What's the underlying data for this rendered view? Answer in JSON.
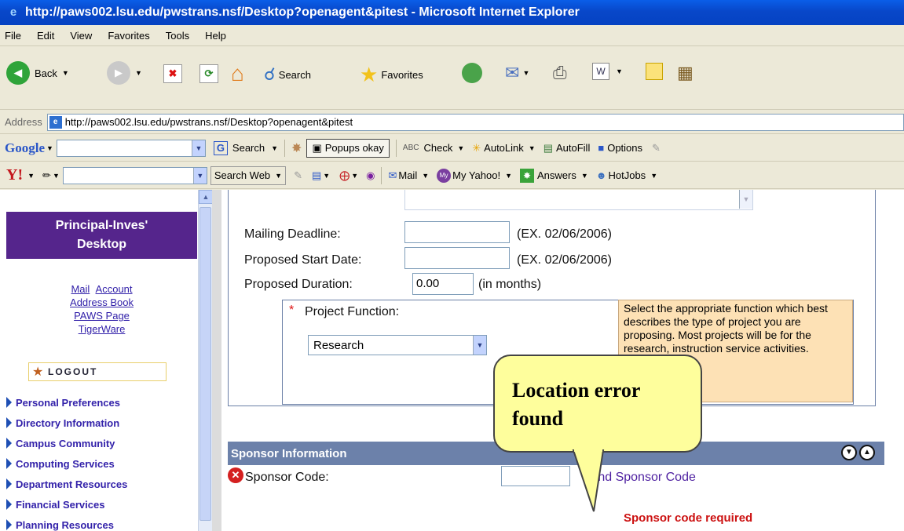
{
  "window": {
    "title": "http://paws002.lsu.edu/pwstrans.nsf/Desktop?openagent&pitest - Microsoft Internet Explorer"
  },
  "menu": [
    "File",
    "Edit",
    "View",
    "Favorites",
    "Tools",
    "Help"
  ],
  "toolbar": {
    "back": "Back",
    "search": "Search",
    "favorites": "Favorites"
  },
  "address": {
    "label": "Address",
    "url": "http://paws002.lsu.edu/pwstrans.nsf/Desktop?openagent&pitest"
  },
  "google": {
    "logo": "Google",
    "search": "Search",
    "popups": "Popups okay",
    "check": "Check",
    "autolink": "AutoLink",
    "autofill": "AutoFill",
    "options": "Options"
  },
  "yahoo": {
    "logo": "Y!",
    "search_web": "Search Web",
    "mail": "Mail",
    "my_yahoo": "My Yahoo!",
    "answers": "Answers",
    "hotjobs": "HotJobs"
  },
  "sidebar": {
    "title_line1": "Principal-Inves'",
    "title_line2": "Desktop",
    "link_mail": "Mail",
    "link_account": "Account",
    "link_address_book": "Address Book",
    "link_paws_page": "PAWS Page",
    "link_tigerware": "TigerWare",
    "logout": "LOGOUT",
    "nav": [
      "Personal Preferences",
      "Directory Information",
      "Campus Community",
      "Computing Services",
      "Department Resources",
      "Financial Services",
      "Planning Resources"
    ]
  },
  "form": {
    "mailing_deadline": "Mailing Deadline:",
    "proposed_start": "Proposed Start Date:",
    "proposed_duration": "Proposed Duration:",
    "date_example_1": "(EX. 02/06/2006)",
    "date_example_2": "(EX. 02/06/2006)",
    "duration_value": "0.00",
    "duration_unit": "(in months)",
    "required_mark": "*",
    "project_function": "Project Function:",
    "project_function_value": "Research",
    "hint_text": "Select the appropriate function which best describes the type of project you are proposing. Most projects will be for the research, instruction service activities.",
    "sponsor_header": "Sponsor Information",
    "sponsor_code": "Sponsor Code:",
    "find_sponsor": "Find Sponsor Code",
    "sponsor_required": "Sponsor code required"
  },
  "callout": {
    "line1": "Location error",
    "line2": "found"
  }
}
